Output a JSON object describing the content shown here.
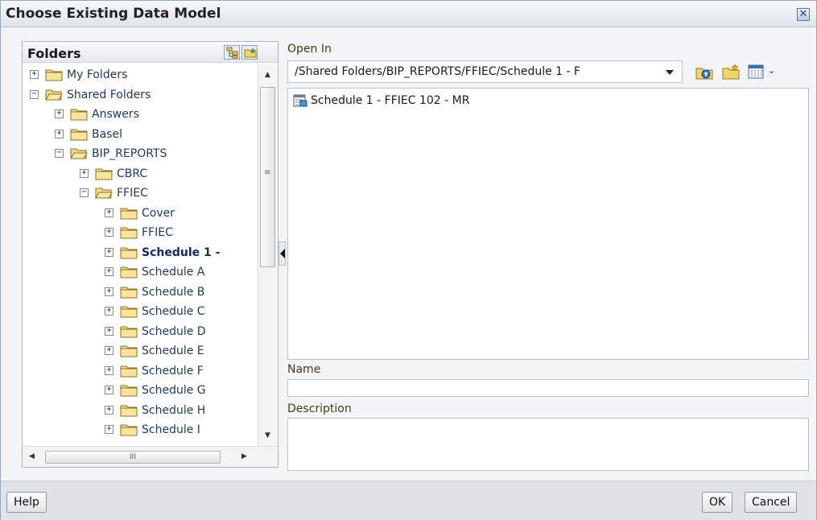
{
  "dialog": {
    "title": "Choose Existing Data Model",
    "close_glyph": "✕"
  },
  "folders": {
    "title": "Folders",
    "tree": [
      {
        "label": "My Folders",
        "expander": "+",
        "open": false
      },
      {
        "label": "Shared Folders",
        "expander": "−",
        "open": true
      },
      {
        "label": "Answers",
        "expander": "+",
        "open": false
      },
      {
        "label": "Basel",
        "expander": "+",
        "open": false
      },
      {
        "label": "BIP_REPORTS",
        "expander": "−",
        "open": true
      },
      {
        "label": "CBRC",
        "expander": "+",
        "open": false
      },
      {
        "label": "FFIEC",
        "expander": "−",
        "open": true
      },
      {
        "label": "Cover",
        "expander": "+",
        "open": false
      },
      {
        "label": "FFIEC",
        "expander": "+",
        "open": false
      },
      {
        "label": "Schedule 1 -",
        "expander": "+",
        "open": false,
        "selected": true
      },
      {
        "label": "Schedule A",
        "expander": "+",
        "open": false
      },
      {
        "label": "Schedule B",
        "expander": "+",
        "open": false
      },
      {
        "label": "Schedule C",
        "expander": "+",
        "open": false
      },
      {
        "label": "Schedule D",
        "expander": "+",
        "open": false
      },
      {
        "label": "Schedule E",
        "expander": "+",
        "open": false
      },
      {
        "label": "Schedule F",
        "expander": "+",
        "open": false
      },
      {
        "label": "Schedule G",
        "expander": "+",
        "open": false
      },
      {
        "label": "Schedule H",
        "expander": "+",
        "open": false
      },
      {
        "label": "Schedule I",
        "expander": "+",
        "open": false
      }
    ],
    "hscroll_grip": "III"
  },
  "open_in": {
    "label": "Open In",
    "path": "/Shared Folders/BIP_REPORTS/FFIEC/Schedule 1 - F"
  },
  "items": [
    {
      "label": "Schedule 1 - FFIEC 102 - MR",
      "icon": "data-model-icon"
    }
  ],
  "name_label": "Name",
  "description_label": "Description",
  "footer": {
    "help": "Help",
    "ok": "OK",
    "cancel": "Cancel"
  }
}
